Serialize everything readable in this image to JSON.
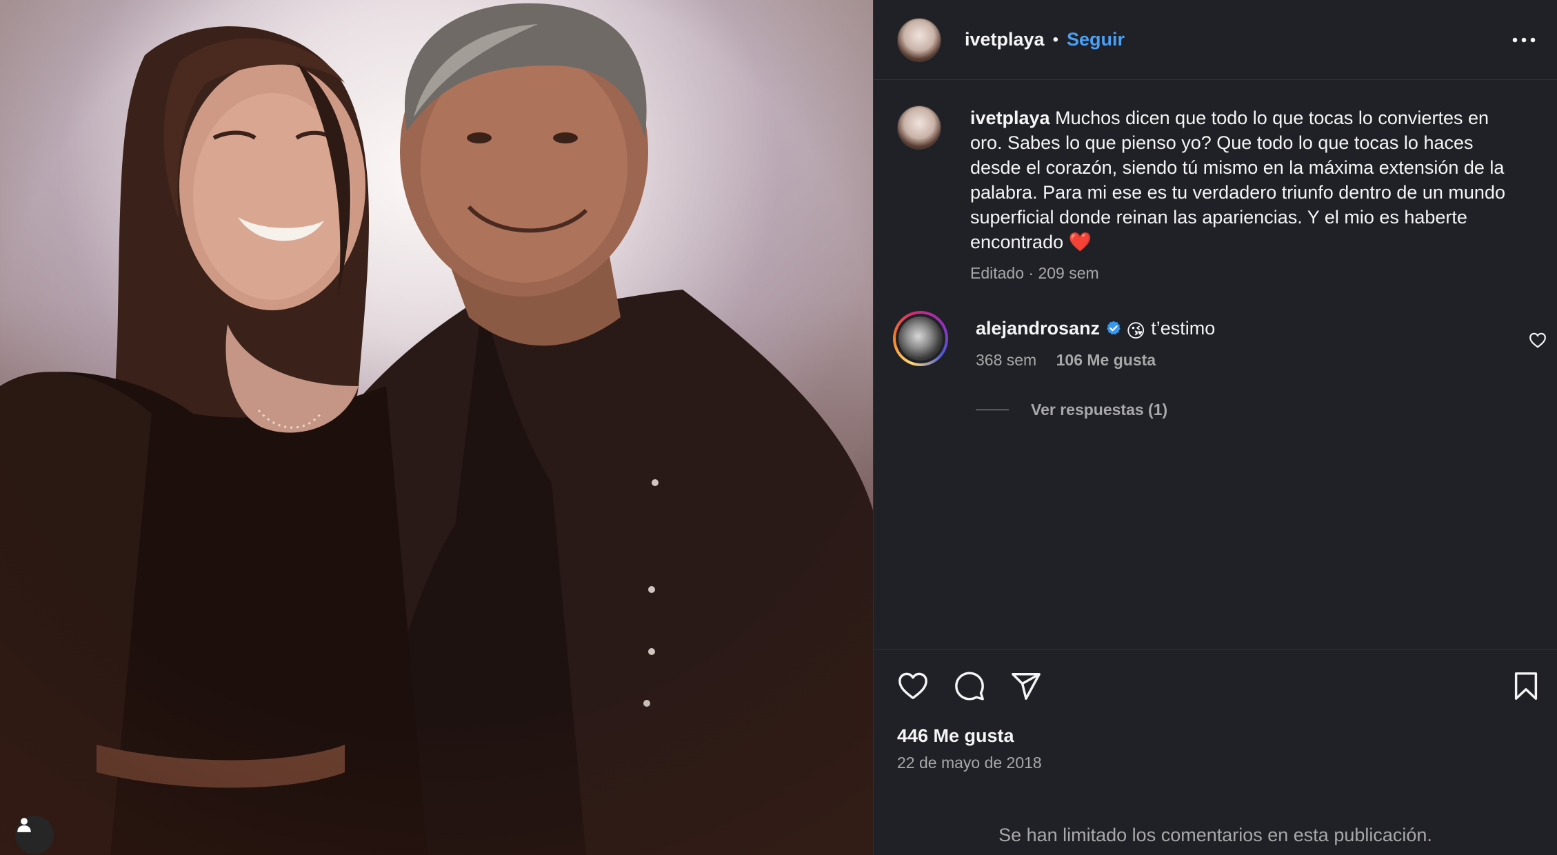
{
  "post": {
    "author": "ivetplaya",
    "separator": "•",
    "follow_label": "Seguir",
    "more_icon": "more-horizontal-icon"
  },
  "caption": {
    "username": "ivetplaya",
    "text": "Muchos dicen que todo lo que tocas lo conviertes en oro. Sabes lo que pienso yo? Que todo lo que tocas lo haces desde el corazón, siendo tú mismo en la máxima extensión de la palabra. Para mi ese es tu verdadero triunfo dentro de un mundo superficial donde reinan las apariencias. Y el mio es haberte encontrado",
    "emoji": "❤️",
    "meta": "Editado · 209 sem"
  },
  "comment": {
    "username": "alejandrosanz",
    "verified": true,
    "emoji": "😘",
    "text": "t’estimo",
    "time": "368 sem",
    "likes": "106 Me gusta",
    "replies_label": "Ver respuestas (1)"
  },
  "footer": {
    "likes": "446 Me gusta",
    "date": "22 de mayo de 2018",
    "limited_notice": "Se han limitado los comentarios en esta publicación."
  },
  "icons": [
    "heart-icon",
    "comment-icon",
    "share-icon",
    "bookmark-icon",
    "user-icon",
    "verified-badge-icon"
  ],
  "colors": {
    "panel_bg": "#1f2126",
    "text_primary": "#f5f5f5",
    "text_secondary": "#a8a8a8",
    "link_blue": "#4aa0f5",
    "verified_blue": "#3897f0",
    "heart_red": "#ed2d3a"
  }
}
